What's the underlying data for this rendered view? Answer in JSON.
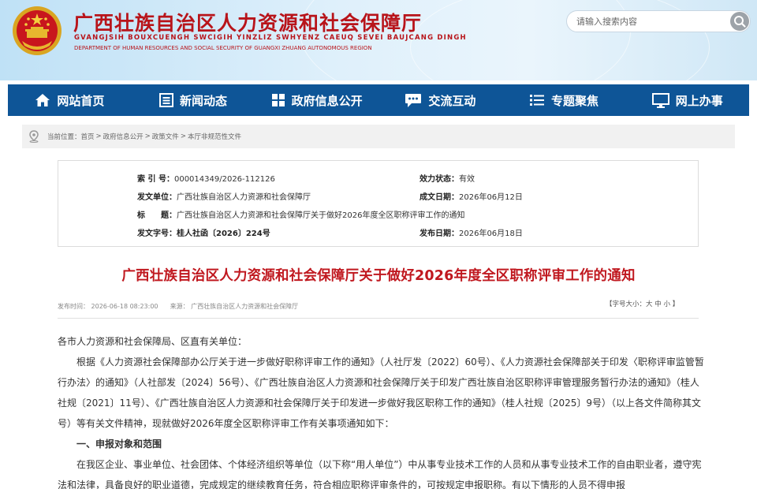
{
  "site": {
    "title_cn": "广西壮族自治区人力资源和社会保障厅",
    "title_zhuang": "GVANGJSIH BOUXCUENGH SWCIGIH YINZLIZ SWHYENZ CAEUQ SEVEI BAUJCANG DINGH",
    "title_en": "DEPARTMENT OF HUMAN RESOURCES AND SOCIAL SECURITY OF GUANGXI ZHUANG AUTONOMOUS REGION"
  },
  "search": {
    "placeholder": "请输入搜索内容"
  },
  "nav": [
    {
      "label": "网站首页",
      "icon": "home-icon"
    },
    {
      "label": "新闻动态",
      "icon": "news-icon"
    },
    {
      "label": "政府信息公开",
      "icon": "grid-icon"
    },
    {
      "label": "交流互动",
      "icon": "chat-icon"
    },
    {
      "label": "专题聚焦",
      "icon": "list-icon"
    },
    {
      "label": "网上办事",
      "icon": "monitor-icon"
    }
  ],
  "breadcrumb": {
    "prefix": "当前位置：",
    "items": [
      "首页",
      "政府信息公开",
      "政策文件",
      "本厅非规范性文件"
    ],
    "sep": ">"
  },
  "meta": {
    "index_label": "索 引 号：",
    "index_value": "000014349/2026-112126",
    "issuer_label": "发文单位：",
    "issuer_value": "广西壮族自治区人力资源和社会保障厅",
    "title_label": "标　　题：",
    "title_value": "广西壮族自治区人力资源和社会保障厅关于做好2026年度全区职称评审工作的通知",
    "docno_label": "发文字号：",
    "docno_value": "桂人社函〔2026〕224号",
    "validity_label": "效力状态：",
    "validity_value": "有效",
    "created_label": "成文日期：",
    "created_value": "2026年06月12日",
    "published_label": "发布日期：",
    "published_value": "2026年06月18日"
  },
  "article": {
    "title": "广西壮族自治区人力资源和社会保障厅关于做好2026年度全区职称评审工作的通知",
    "pub_time": "发布时间：  2026-06-18 08:23:00",
    "source": "来源：  广西壮族自治区人力资源和社会保障厅",
    "fontsize_open": "【字号大小：",
    "fontsize_large": "大",
    "fontsize_medium": "中",
    "fontsize_small": "小",
    "fontsize_close": "】",
    "salutation": "各市人力资源和社会保障局、区直有关单位：",
    "para1": "根据《人力资源社会保障部办公厅关于进一步做好职称评审工作的通知》（人社厅发〔2022〕60号）、《人力资源社会保障部关于印发〈职称评审监管暂行办法〉的通知》（人社部发〔2024〕56号）、《广西壮族自治区人力资源和社会保障厅关于印发广西壮族自治区职称评审管理服务暂行办法的通知》（桂人社规〔2021〕11号）、《广西壮族自治区人力资源和社会保障厅关于印发进一步做好我区职称工作的通知》（桂人社规〔2025〕9号）（以上各文件简称其文号）等有关文件精神，现就做好2026年度全区职称评审工作有关事项通知如下：",
    "section1": "一、申报对象和范围",
    "para2": "在我区企业、事业单位、社会团体、个体经济组织等单位（以下称“用人单位”）中从事专业技术工作的人员和从事专业技术工作的自由职业者，遵守宪法和法律，具备良好的职业道德，完成规定的继续教育任务，符合相应职称评审条件的，可按规定申报职称。有以下情形的人员不得申报"
  },
  "colors": {
    "brand_red": "#b8141a",
    "nav_blue": "#0e5597",
    "title_red": "#c0181f"
  }
}
